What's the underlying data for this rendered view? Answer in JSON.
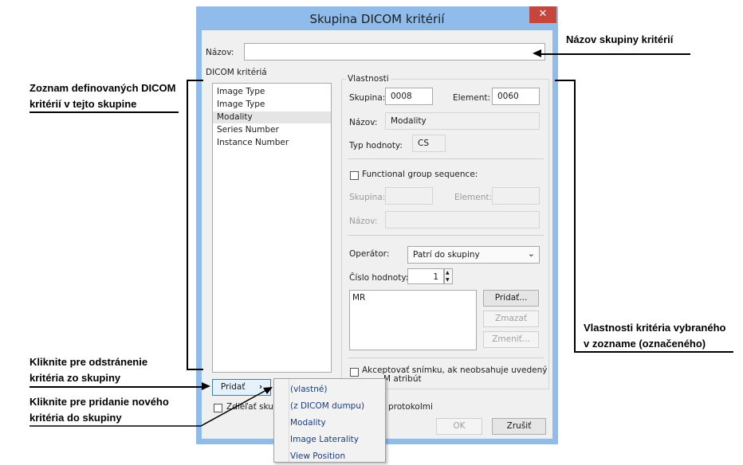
{
  "dialog": {
    "title": "Skupina DICOM kritérií",
    "close_glyph": "✕",
    "name_label": "Názov:",
    "name_value": "",
    "criteria_section_label": "DICOM kritériá",
    "criteria_items": [
      "Image Type",
      "Image Type",
      "Modality",
      "Series Number",
      "Instance Number"
    ],
    "selected_index": 2,
    "add_button_label": "Pridať",
    "add_button_arrow": "›",
    "share_label_visible": "Zdieľať skup",
    "share_label_tail": "protokolmi",
    "ok_label": "OK",
    "cancel_label": "Zrušiť"
  },
  "properties": {
    "section_label": "Vlastnosti",
    "group_label": "Skupina:",
    "group_value": "0008",
    "element_label": "Element:",
    "element_value": "0060",
    "name_label": "Názov:",
    "name_value": "Modality",
    "value_type_label": "Typ hodnoty:",
    "value_type_value": "CS",
    "functional_group_label": "Functional group sequence:",
    "fg_group_label": "Skupina:",
    "fg_element_label": "Element:",
    "fg_name_label": "Názov:",
    "operator_label": "Operátor:",
    "operator_value": "Patrí do skupiny",
    "value_number_label": "Číslo hodnoty:",
    "value_number": "1",
    "values": [
      "MR"
    ],
    "add_value_label": "Pridať...",
    "delete_value_label": "Zmazať",
    "change_value_label": "Zmeniť...",
    "accept_line1": "Akceptovať snímku, ak neobsahuje uvedený",
    "accept_line2_visible": "M atribút"
  },
  "add_menu": {
    "items": [
      "(vlastné)",
      "(z DICOM dumpu)",
      "Modality",
      "Image Laterality",
      "View Position"
    ]
  },
  "annotations": {
    "group_name": "Názov skupiny kritérií",
    "criteria_list_line1": "Zoznam definovaných DICOM",
    "criteria_list_line2": "kritérií v tejto skupine",
    "remove_line1": "Kliknite pre odstránenie",
    "remove_line2": "kritéria zo skupiny",
    "add_line1": "Kliknite pre pridanie nového",
    "add_line2": "kritéria do skupiny",
    "props_line1": "Vlastnosti kritéria vybraného",
    "props_line2": "v zozname (označeného)"
  },
  "colors": {
    "title_bar": "#8fbcea",
    "close_button": "#c7463c",
    "selection": "#e5e5e5",
    "menu_text": "#1a3d8a"
  }
}
